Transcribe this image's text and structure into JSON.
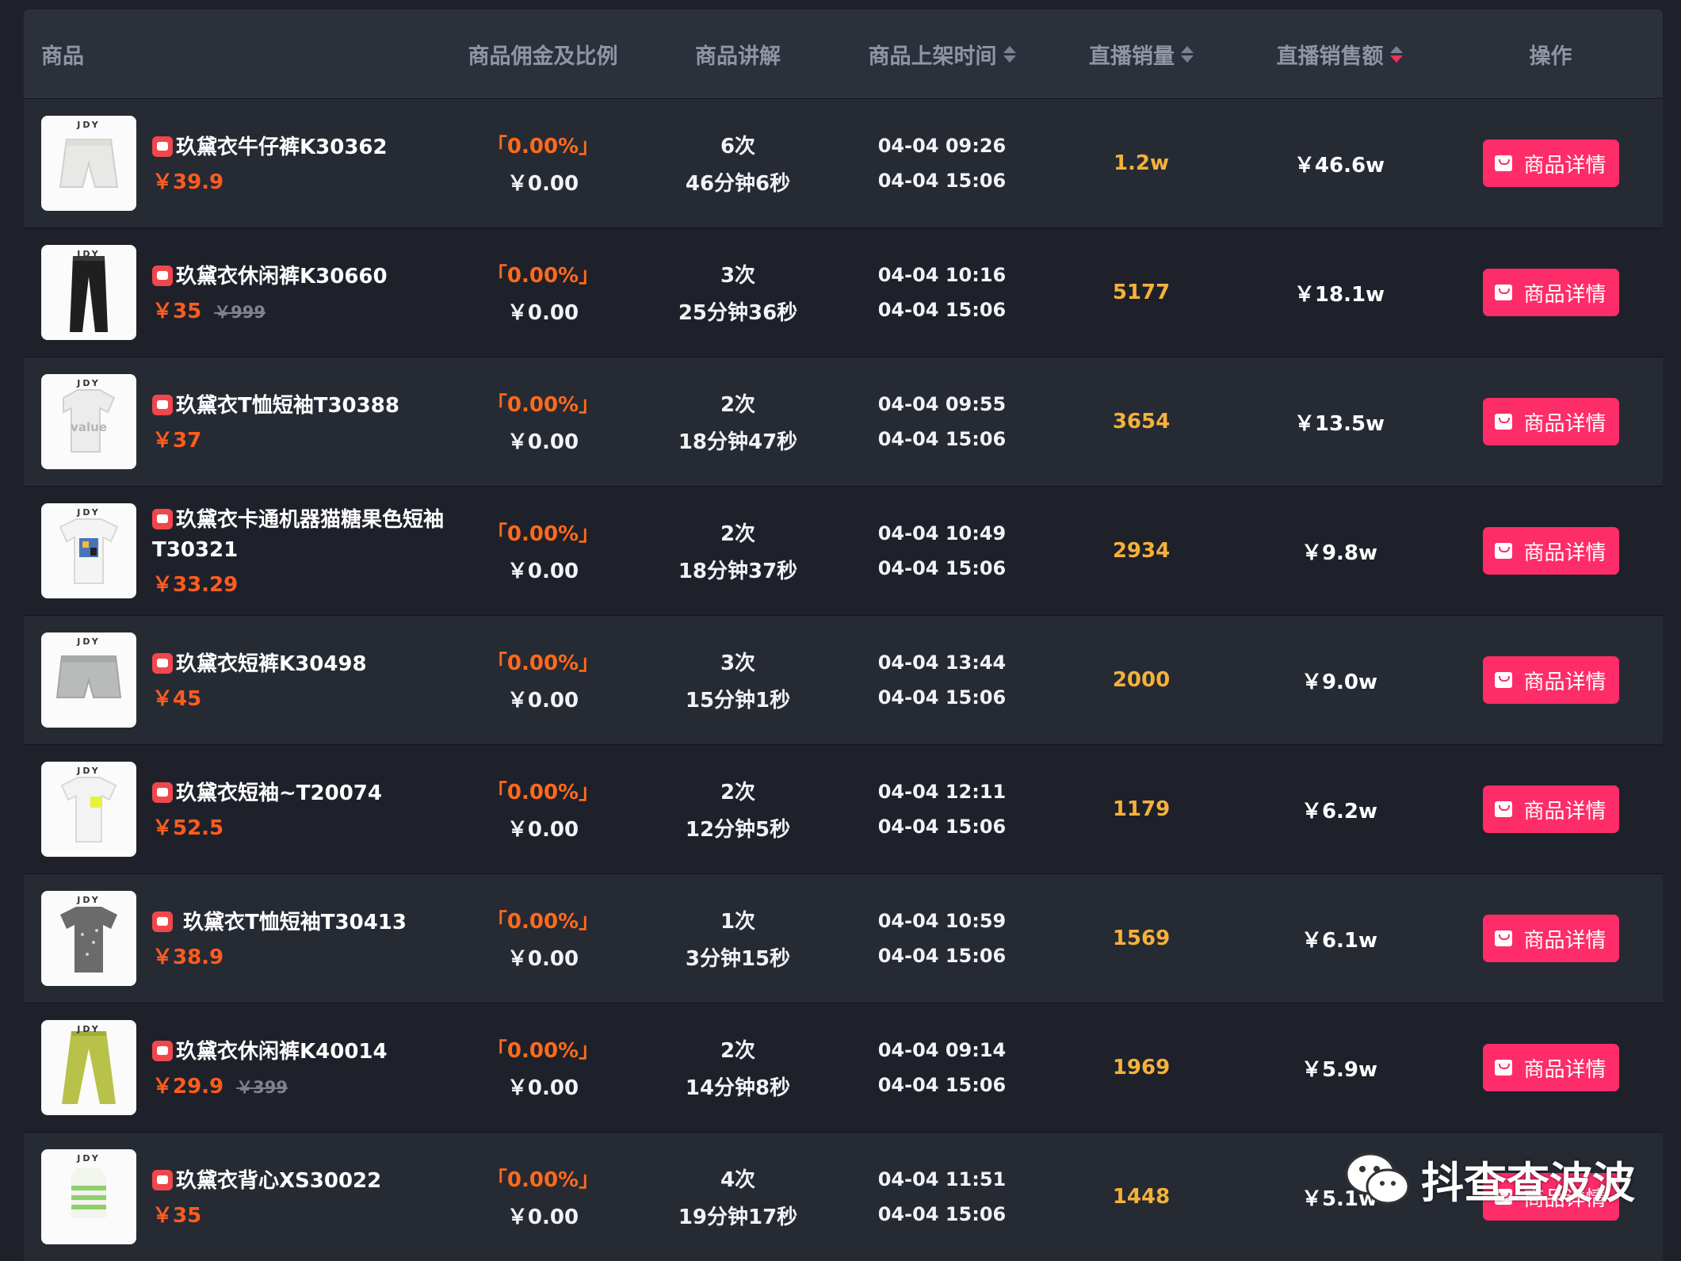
{
  "header": {
    "product": "商品",
    "commission": "商品佣金及比例",
    "explain": "商品讲解",
    "listing_time": "商品上架时间",
    "live_sales": "直播销量",
    "live_amount": "直播销售额",
    "operation": "操作"
  },
  "colors": {
    "accent": "#fe2c69",
    "price": "#ff5c1f",
    "sales": "#f5b13a"
  },
  "rows": [
    {
      "name": "玖黛衣牛仔裤K30362",
      "price": "￥39.9",
      "oprice": "",
      "rate": "「0.00%」",
      "comm": "￥0.00",
      "times": "6次",
      "duration": "46分钟6秒",
      "t1": "04-04 09:26",
      "t2": "04-04 15:06",
      "sales": "1.2w",
      "amount": "￥46.6w",
      "btn": "商品详情",
      "thumb": "shorts-white"
    },
    {
      "name": "玖黛衣休闲裤K30660",
      "price": "￥35",
      "oprice": "￥999",
      "rate": "「0.00%」",
      "comm": "￥0.00",
      "times": "3次",
      "duration": "25分钟36秒",
      "t1": "04-04 10:16",
      "t2": "04-04 15:06",
      "sales": "5177",
      "amount": "￥18.1w",
      "btn": "商品详情",
      "thumb": "pants-black"
    },
    {
      "name": "玖黛衣T恤短袖T30388",
      "price": "￥37",
      "oprice": "",
      "rate": "「0.00%」",
      "comm": "￥0.00",
      "times": "2次",
      "duration": "18分钟47秒",
      "t1": "04-04 09:55",
      "t2": "04-04 15:06",
      "sales": "3654",
      "amount": "￥13.5w",
      "btn": "商品详情",
      "thumb": "tee-value"
    },
    {
      "name": "玖黛衣卡通机器猫糖果色短袖T30321",
      "price": "￥33.29",
      "oprice": "",
      "rate": "「0.00%」",
      "comm": "￥0.00",
      "times": "2次",
      "duration": "18分钟37秒",
      "t1": "04-04 10:49",
      "t2": "04-04 15:06",
      "sales": "2934",
      "amount": "￥9.8w",
      "btn": "商品详情",
      "thumb": "tee-print"
    },
    {
      "name": "玖黛衣短裤K30498",
      "price": "￥45",
      "oprice": "",
      "rate": "「0.00%」",
      "comm": "￥0.00",
      "times": "3次",
      "duration": "15分钟1秒",
      "t1": "04-04 13:44",
      "t2": "04-04 15:06",
      "sales": "2000",
      "amount": "￥9.0w",
      "btn": "商品详情",
      "thumb": "shorts-grey"
    },
    {
      "name": "玖黛衣短袖~T20074",
      "price": "￥52.5",
      "oprice": "",
      "rate": "「0.00%」",
      "comm": "￥0.00",
      "times": "2次",
      "duration": "12分钟5秒",
      "t1": "04-04 12:11",
      "t2": "04-04 15:06",
      "sales": "1179",
      "amount": "￥6.2w",
      "btn": "商品详情",
      "thumb": "tee-yellow"
    },
    {
      "name": " 玖黛衣T恤短袖T30413",
      "price": "￥38.9",
      "oprice": "",
      "rate": "「0.00%」",
      "comm": "￥0.00",
      "times": "1次",
      "duration": "3分钟15秒",
      "t1": "04-04 10:59",
      "t2": "04-04 15:06",
      "sales": "1569",
      "amount": "￥6.1w",
      "btn": "商品详情",
      "thumb": "tee-dark"
    },
    {
      "name": "玖黛衣休闲裤K40014",
      "price": "￥29.9",
      "oprice": "￥399",
      "rate": "「0.00%」",
      "comm": "￥0.00",
      "times": "2次",
      "duration": "14分钟8秒",
      "t1": "04-04 09:14",
      "t2": "04-04 15:06",
      "sales": "1969",
      "amount": "￥5.9w",
      "btn": "商品详情",
      "thumb": "pants-green"
    },
    {
      "name": "玖黛衣背心XS30022",
      "price": "￥35",
      "oprice": "",
      "rate": "「0.00%」",
      "comm": "￥0.00",
      "times": "4次",
      "duration": "19分钟17秒",
      "t1": "04-04 11:51",
      "t2": "04-04 15:06",
      "sales": "1448",
      "amount": "￥5.1w",
      "btn": "商品详情",
      "thumb": "vest-stripe"
    }
  ],
  "brand_tag": "JDY",
  "watermark": "抖查查波波"
}
